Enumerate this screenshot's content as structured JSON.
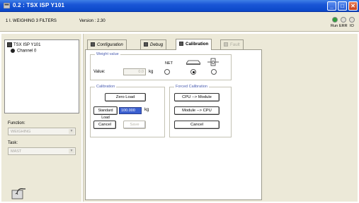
{
  "window": {
    "title": "0.2 : TSX ISP Y101",
    "controls": {
      "minimize": "_",
      "maximize": "□",
      "close": "✕"
    }
  },
  "infobar": {
    "module_name": "1 I. WEIGHING 3 FILTERS",
    "version": "Version : 2.30",
    "leds": [
      {
        "label": "Run",
        "color": "#2f9f3a"
      },
      {
        "label": "ERR",
        "color": "#e0ded4"
      },
      {
        "label": "IO",
        "color": "#e0ded4"
      }
    ]
  },
  "tree": {
    "module": "TSX ISP Y101",
    "channel": "Channel 0"
  },
  "sidebar": {
    "function_label": "Function:",
    "function_value": "WEIGHING",
    "task_label": "Task:",
    "task_value": "MAST"
  },
  "tabs": [
    {
      "label": "Configuration",
      "state": "normal"
    },
    {
      "label": "Debug",
      "state": "normal"
    },
    {
      "label": "Calibration",
      "state": "active"
    },
    {
      "label": "Fault",
      "state": "disabled"
    }
  ],
  "weight_value": {
    "title": "Weight value",
    "value_label": "Value:",
    "value": "0.0",
    "unit": "kg",
    "net_label": "NET",
    "radios": [
      {
        "name": "net",
        "checked": false
      },
      {
        "name": "gross",
        "checked": true
      },
      {
        "name": "zero",
        "checked": false
      }
    ]
  },
  "calibration": {
    "title": "Calibration",
    "zero_load_label": "Zero Load",
    "standard_load_label": "Standard Load",
    "standard_load_value": "100.000",
    "standard_load_unit": "kg",
    "cancel_label": "Cancel",
    "save_label": "Save"
  },
  "forced_calibration": {
    "title": "Forced Calibration",
    "cpu_to_module_label": "CPU --> Module",
    "module_to_cpu_label": "Module --> CPU",
    "cancel_label": "Cancel"
  }
}
